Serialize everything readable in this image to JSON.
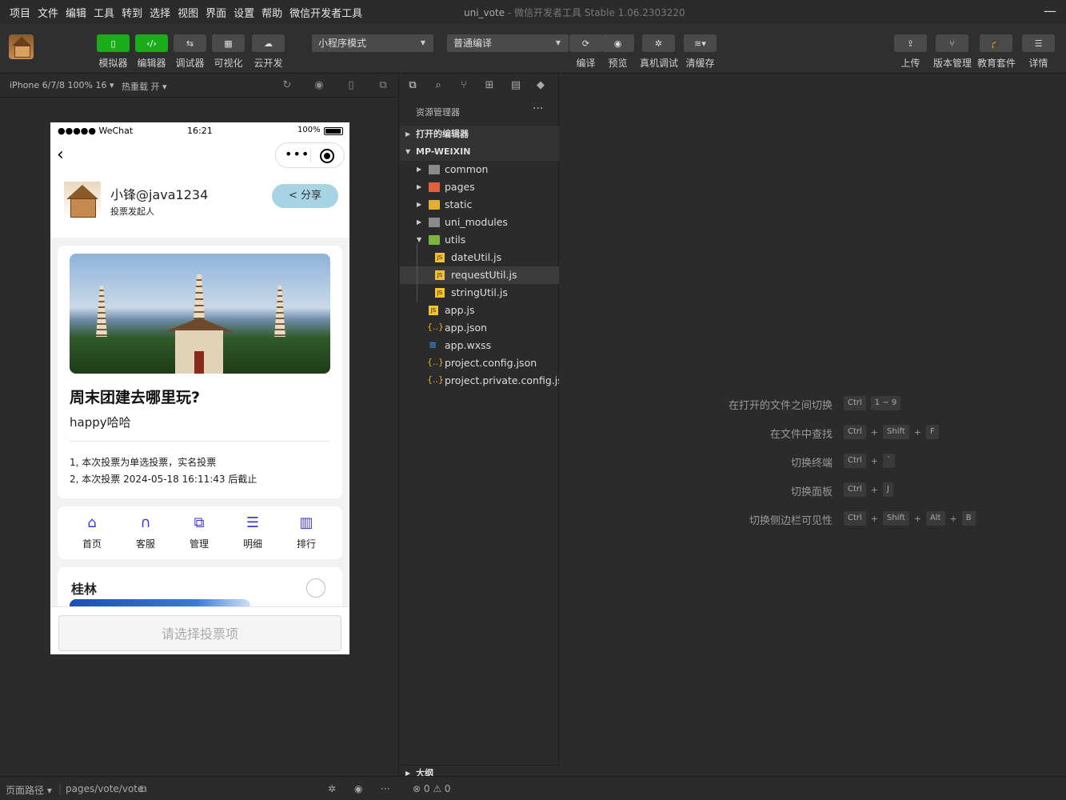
{
  "menubar": {
    "items": [
      "项目",
      "文件",
      "编辑",
      "工具",
      "转到",
      "选择",
      "视图",
      "界面",
      "设置",
      "帮助",
      "微信开发者工具"
    ],
    "title_project": "uni_vote",
    "title_app": "- 微信开发者工具 Stable 1.06.2303220"
  },
  "toolbar": {
    "left_buttons": [
      {
        "label": "模拟器",
        "icon": "phone-icon"
      },
      {
        "label": "编辑器",
        "icon": "code-icon"
      },
      {
        "label": "调试器",
        "icon": "debug-icon"
      },
      {
        "label": "可视化",
        "icon": "layout-icon"
      },
      {
        "label": "云开发",
        "icon": "cloud-icon"
      }
    ],
    "mode_select": "小程序模式",
    "compile_select": "普通编译",
    "mid_buttons": [
      {
        "label": "编译",
        "icon": "refresh-icon"
      },
      {
        "label": "预览",
        "icon": "eye-icon"
      },
      {
        "label": "真机调试",
        "icon": "bug-icon"
      },
      {
        "label": "清缓存",
        "icon": "layers-icon"
      }
    ],
    "right_buttons": [
      {
        "label": "上传",
        "icon": "upload-icon"
      },
      {
        "label": "版本管理",
        "icon": "branch-icon"
      },
      {
        "label": "教育套件",
        "icon": "graduation-cap-icon"
      },
      {
        "label": "详情",
        "icon": "menu-icon"
      }
    ]
  },
  "simulator": {
    "device": "iPhone 6/7/8 100% 16 ▾",
    "hot_reload": "热重载 开 ▾",
    "status_carrier": "●●●●● WeChat",
    "status_time": "16:21",
    "status_battery": "100%",
    "capsule_dots": "•••",
    "user_name": "小锋@java1234",
    "user_role": "投票发起人",
    "share_label": "< 分享",
    "vote_title": "周末团建去哪里玩?",
    "vote_desc": "happy哈哈",
    "rule_1": "1, 本次投票为单选投票，实名投票",
    "rule_2": "2, 本次投票 2024-05-18 16:11:43 后截止",
    "nav": [
      {
        "label": "首页",
        "icon": "home-icon"
      },
      {
        "label": "客服",
        "icon": "headset-icon"
      },
      {
        "label": "管理",
        "icon": "copy-icon"
      },
      {
        "label": "明细",
        "icon": "list-icon"
      },
      {
        "label": "排行",
        "icon": "bar-chart-icon"
      }
    ],
    "option_1": "桂林",
    "vote_button": "请选择投票项"
  },
  "explorer": {
    "header": "资源管理器",
    "more": "···",
    "open_editors": "打开的编辑器",
    "project": "MP-WEIXIN",
    "tree": [
      {
        "name": "common",
        "type": "folder"
      },
      {
        "name": "pages",
        "type": "folder-red"
      },
      {
        "name": "static",
        "type": "folder-yellow"
      },
      {
        "name": "uni_modules",
        "type": "folder"
      },
      {
        "name": "utils",
        "type": "folder-green"
      },
      {
        "name": "dateUtil.js",
        "type": "js"
      },
      {
        "name": "requestUtil.js",
        "type": "js"
      },
      {
        "name": "stringUtil.js",
        "type": "js"
      },
      {
        "name": "app.js",
        "type": "js"
      },
      {
        "name": "app.json",
        "type": "json"
      },
      {
        "name": "app.wxss",
        "type": "wxss"
      },
      {
        "name": "project.config.json",
        "type": "json"
      },
      {
        "name": "project.private.config.js...",
        "type": "json"
      }
    ],
    "outline": "大纲"
  },
  "shortcuts": [
    {
      "label": "在打开的文件之间切换",
      "keys": [
        "Ctrl",
        "1 ~ 9"
      ]
    },
    {
      "label": "在文件中查找",
      "keys": [
        "Ctrl",
        "Shift",
        "F"
      ]
    },
    {
      "label": "切换终端",
      "keys": [
        "Ctrl",
        "`"
      ]
    },
    {
      "label": "切换面板",
      "keys": [
        "Ctrl",
        "J"
      ]
    },
    {
      "label": "切换侧边栏可见性",
      "keys": [
        "Ctrl",
        "Shift",
        "Alt",
        "B"
      ]
    }
  ],
  "statusbar": {
    "page_path_label": "页面路径 ▾",
    "page_path": "pages/vote/vote",
    "problems": "⊗ 0 ⚠ 0",
    "more": "···"
  }
}
